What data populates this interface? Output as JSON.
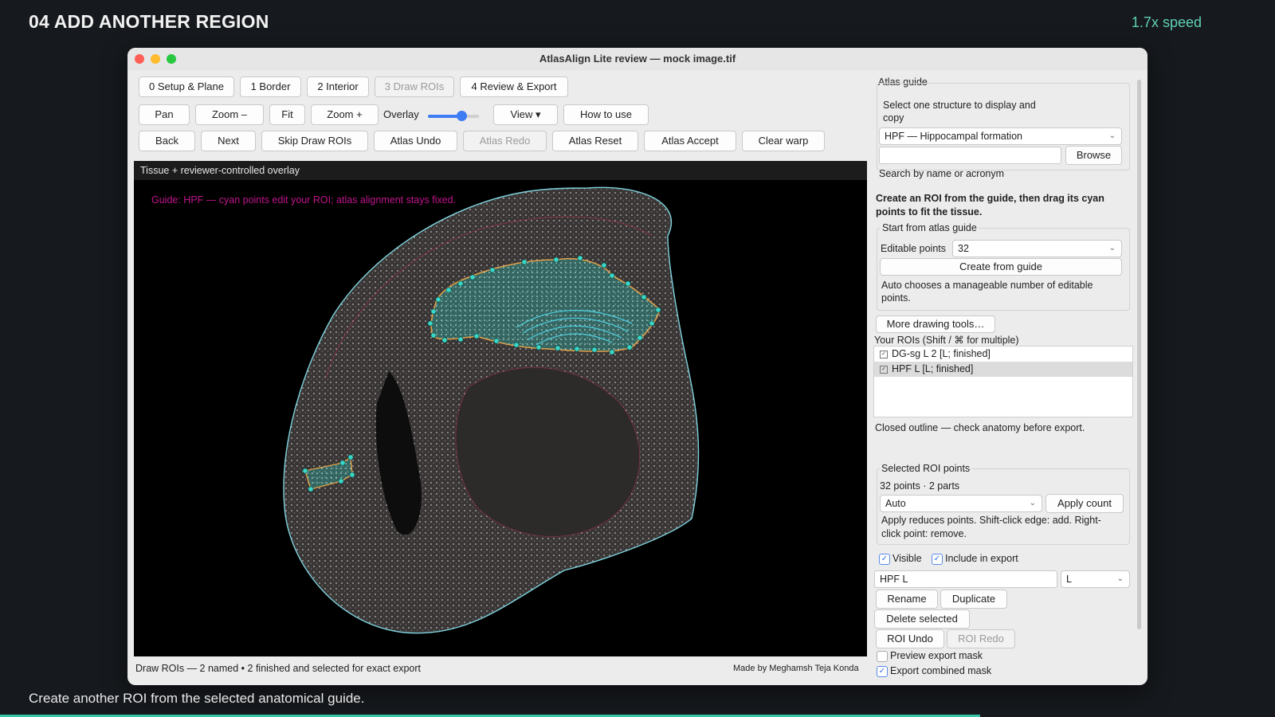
{
  "slide": {
    "title": "04  ADD ANOTHER REGION",
    "speed": "1.7x speed",
    "caption": "Create another ROI from the selected anatomical guide."
  },
  "window": {
    "title": "AtlasAlign Lite review — mock image.tif"
  },
  "steps": [
    {
      "label": "0 Setup & Plane",
      "enabled": true
    },
    {
      "label": "1 Border",
      "enabled": true
    },
    {
      "label": "2 Interior",
      "enabled": true
    },
    {
      "label": "3 Draw ROIs",
      "enabled": false
    },
    {
      "label": "4 Review & Export",
      "enabled": true
    }
  ],
  "toolbar": {
    "pan": "Pan",
    "zoom_out": "Zoom –",
    "fit": "Fit",
    "zoom_in": "Zoom +",
    "overlay_label": "Overlay",
    "overlay_value": 0.65,
    "view": "View ▾",
    "how_to_use": "How to use"
  },
  "actions": {
    "back": "Back",
    "next": "Next",
    "skip": "Skip Draw ROIs",
    "atlas_undo": "Atlas Undo",
    "atlas_redo": "Atlas Redo",
    "atlas_reset": "Atlas Reset",
    "atlas_accept": "Atlas Accept",
    "clear_warp": "Clear warp"
  },
  "viewer": {
    "header": "Tissue + reviewer-controlled overlay",
    "guide_text": "Guide: HPF — cyan points edit your ROI; atlas alignment stays fixed.",
    "status": "Draw ROIs — 2 named • 2 finished and selected for exact export",
    "credit": "Made by Meghamsh Teja Konda"
  },
  "panel": {
    "atlas_guide_label": "Atlas guide",
    "select_instruction": "Select one structure to display and copy",
    "structure_value": "HPF — Hippocampal formation",
    "search_value": "",
    "browse": "Browse",
    "search_hint": "Search by name or acronym",
    "create_instruction": "Create an ROI from the guide, then drag its cyan points to fit the tissue.",
    "start_label": "Start from atlas guide",
    "editable_points_label": "Editable points",
    "editable_points_value": "32",
    "create_button": "Create from guide",
    "auto_note": "Auto chooses a manageable number of editable points.",
    "more_tools": "More drawing tools…",
    "rois_label": "Your ROIs (Shift / ⌘ for multiple)",
    "rois": [
      {
        "label": "DG-sg L 2  [L; finished]",
        "selected": false
      },
      {
        "label": "HPF L  [L; finished]",
        "selected": true
      }
    ],
    "closed_note": "Closed outline — check anatomy before export.",
    "selected_points_label": "Selected ROI points",
    "points_count": "32 points · 2 parts",
    "count_mode": "Auto",
    "apply_count": "Apply count",
    "apply_note": "Apply reduces points. Shift-click edge: add. Right-click point: remove.",
    "visible_label": "Visible",
    "include_label": "Include in export",
    "roi_name": "HPF L",
    "hemisphere": "L",
    "rename": "Rename",
    "duplicate": "Duplicate",
    "delete_selected": "Delete selected",
    "roi_undo": "ROI Undo",
    "roi_redo": "ROI Redo",
    "preview_mask": "Preview export mask",
    "export_combined": "Export combined mask"
  },
  "colors": {
    "accent": "#3d7cf2",
    "roi_cyan": "#3ad6c6",
    "guide_magenta": "#c0148c",
    "speed_text": "#5fd0b6"
  }
}
